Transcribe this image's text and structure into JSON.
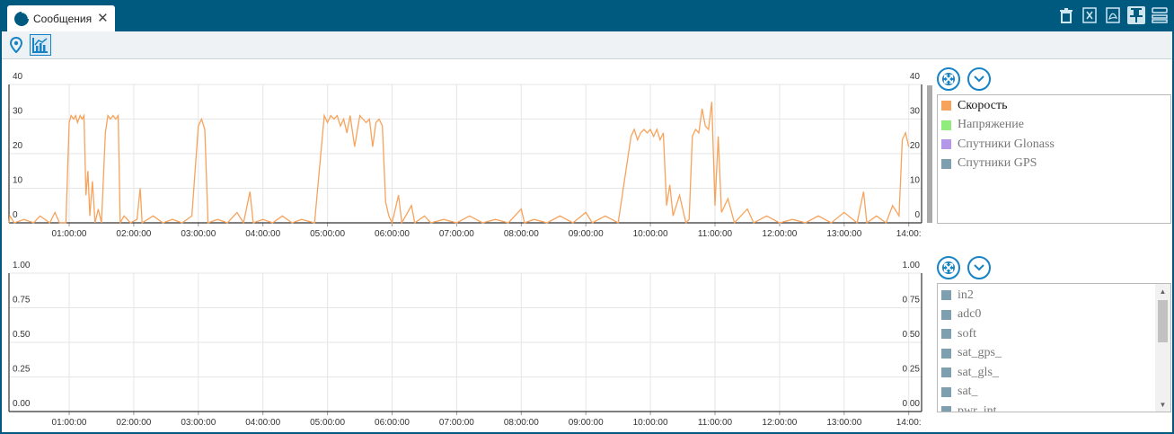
{
  "tab": {
    "label": "Сообщения",
    "close": "✕",
    "icon": "pie-chart-icon"
  },
  "titlebar_icons": [
    "trash-icon",
    "excel-icon",
    "pdf-icon",
    "pin-icon",
    "layout-icon"
  ],
  "toolbar_icons": [
    "location-pin-icon",
    "chart-icon"
  ],
  "colors": {
    "brand": "#005a7f",
    "accent": "#1783c4",
    "speed": "#f7a35c",
    "grid": "#e4e4e4"
  },
  "chart_data": [
    {
      "type": "line",
      "x_ticks": [
        "01:00:00",
        "02:00:00",
        "03:00:00",
        "04:00:00",
        "05:00:00",
        "06:00:00",
        "07:00:00",
        "08:00:00",
        "09:00:00",
        "10:00:00",
        "11:00:00",
        "12:00:00",
        "13:00:00",
        "14:00:"
      ],
      "y_ticks_left": [
        "40",
        "30",
        "20",
        "10",
        "0"
      ],
      "y_ticks_right": [
        "40",
        "30",
        "20",
        "10",
        "0"
      ],
      "ylim": [
        0,
        40
      ],
      "series": [
        {
          "name": "Скорость",
          "x_unit": "hours",
          "points": [
            [
              0.0,
              0
            ],
            [
              0.08,
              2
            ],
            [
              0.15,
              0
            ],
            [
              0.3,
              1
            ],
            [
              0.45,
              0
            ],
            [
              0.55,
              2
            ],
            [
              0.7,
              0
            ],
            [
              0.78,
              3
            ],
            [
              0.85,
              0
            ],
            [
              0.95,
              0
            ],
            [
              1.0,
              29
            ],
            [
              1.03,
              31
            ],
            [
              1.07,
              30
            ],
            [
              1.1,
              31
            ],
            [
              1.13,
              29
            ],
            [
              1.17,
              31
            ],
            [
              1.2,
              30
            ],
            [
              1.23,
              31
            ],
            [
              1.26,
              8
            ],
            [
              1.29,
              15
            ],
            [
              1.32,
              2
            ],
            [
              1.36,
              12
            ],
            [
              1.4,
              0
            ],
            [
              1.45,
              4
            ],
            [
              1.5,
              0
            ],
            [
              1.56,
              26
            ],
            [
              1.6,
              31
            ],
            [
              1.64,
              30
            ],
            [
              1.68,
              31
            ],
            [
              1.72,
              30
            ],
            [
              1.76,
              31
            ],
            [
              1.79,
              0
            ],
            [
              1.85,
              2
            ],
            [
              1.95,
              0
            ],
            [
              2.05,
              1
            ],
            [
              2.1,
              10
            ],
            [
              2.13,
              0
            ],
            [
              2.3,
              2
            ],
            [
              2.45,
              0
            ],
            [
              2.6,
              1
            ],
            [
              2.75,
              0
            ],
            [
              2.9,
              2
            ],
            [
              3.0,
              28
            ],
            [
              3.05,
              30
            ],
            [
              3.1,
              27
            ],
            [
              3.15,
              0
            ],
            [
              3.3,
              1
            ],
            [
              3.45,
              0
            ],
            [
              3.6,
              3
            ],
            [
              3.7,
              0
            ],
            [
              3.8,
              9
            ],
            [
              3.85,
              0
            ],
            [
              4.0,
              1
            ],
            [
              4.15,
              0
            ],
            [
              4.3,
              2
            ],
            [
              4.45,
              0
            ],
            [
              4.6,
              1
            ],
            [
              4.8,
              0
            ],
            [
              4.95,
              31
            ],
            [
              5.0,
              29
            ],
            [
              5.05,
              31
            ],
            [
              5.1,
              30
            ],
            [
              5.15,
              31
            ],
            [
              5.2,
              28
            ],
            [
              5.25,
              30
            ],
            [
              5.3,
              26
            ],
            [
              5.35,
              31
            ],
            [
              5.42,
              22
            ],
            [
              5.5,
              31
            ],
            [
              5.55,
              30
            ],
            [
              5.6,
              29
            ],
            [
              5.65,
              30
            ],
            [
              5.7,
              22
            ],
            [
              5.75,
              29
            ],
            [
              5.8,
              30
            ],
            [
              5.85,
              28
            ],
            [
              5.9,
              6
            ],
            [
              5.95,
              2
            ],
            [
              6.0,
              0
            ],
            [
              6.1,
              8
            ],
            [
              6.15,
              0
            ],
            [
              6.3,
              5
            ],
            [
              6.35,
              0
            ],
            [
              6.5,
              2
            ],
            [
              6.6,
              0
            ],
            [
              6.8,
              1
            ],
            [
              7.0,
              0
            ],
            [
              7.2,
              2
            ],
            [
              7.4,
              0
            ],
            [
              7.6,
              1
            ],
            [
              7.8,
              0
            ],
            [
              8.0,
              4
            ],
            [
              8.05,
              0
            ],
            [
              8.2,
              1
            ],
            [
              8.4,
              0
            ],
            [
              8.6,
              2
            ],
            [
              8.8,
              0
            ],
            [
              9.0,
              3
            ],
            [
              9.1,
              0
            ],
            [
              9.3,
              2
            ],
            [
              9.5,
              0
            ],
            [
              9.7,
              25
            ],
            [
              9.75,
              27
            ],
            [
              9.8,
              24
            ],
            [
              9.85,
              26
            ],
            [
              9.9,
              27
            ],
            [
              9.95,
              26
            ],
            [
              10.0,
              27
            ],
            [
              10.05,
              25
            ],
            [
              10.1,
              27
            ],
            [
              10.15,
              24
            ],
            [
              10.2,
              26
            ],
            [
              10.25,
              5
            ],
            [
              10.3,
              11
            ],
            [
              10.35,
              2
            ],
            [
              10.45,
              8
            ],
            [
              10.55,
              0
            ],
            [
              10.6,
              1
            ],
            [
              10.65,
              25
            ],
            [
              10.7,
              27
            ],
            [
              10.75,
              26
            ],
            [
              10.8,
              33
            ],
            [
              10.85,
              28
            ],
            [
              10.9,
              27
            ],
            [
              10.95,
              35
            ],
            [
              11.0,
              5
            ],
            [
              11.05,
              25
            ],
            [
              11.1,
              3
            ],
            [
              11.2,
              7
            ],
            [
              11.3,
              0
            ],
            [
              11.5,
              4
            ],
            [
              11.6,
              0
            ],
            [
              11.8,
              2
            ],
            [
              12.0,
              0
            ],
            [
              12.2,
              1
            ],
            [
              12.4,
              0
            ],
            [
              12.6,
              2
            ],
            [
              12.8,
              0
            ],
            [
              13.0,
              3
            ],
            [
              13.2,
              0
            ],
            [
              13.3,
              9
            ],
            [
              13.35,
              0
            ],
            [
              13.5,
              2
            ],
            [
              13.65,
              0
            ],
            [
              13.75,
              5
            ],
            [
              13.85,
              2
            ],
            [
              13.9,
              24
            ],
            [
              13.95,
              26
            ],
            [
              14.0,
              22
            ]
          ]
        }
      ]
    },
    {
      "type": "line",
      "x_ticks": [
        "01:00:00",
        "02:00:00",
        "03:00:00",
        "04:00:00",
        "05:00:00",
        "06:00:00",
        "07:00:00",
        "08:00:00",
        "09:00:00",
        "10:00:00",
        "11:00:00",
        "12:00:00",
        "13:00:00",
        "14:00:"
      ],
      "y_ticks_left": [
        "1.00",
        "0.75",
        "0.50",
        "0.25",
        "0.00"
      ],
      "y_ticks_right": [
        "1.00",
        "0.75",
        "0.50",
        "0.25",
        "0.00"
      ],
      "ylim": [
        0,
        1
      ],
      "series": []
    }
  ],
  "legend_top": [
    {
      "label": "Скорость",
      "color": "#f7a35c",
      "on": true
    },
    {
      "label": "Напряжение",
      "color": "#90ed7d",
      "on": false
    },
    {
      "label": "Спутники Glonass",
      "color": "#b497e8",
      "on": false
    },
    {
      "label": "Спутники GPS",
      "color": "#7e9faf",
      "on": false
    }
  ],
  "legend_bottom": [
    {
      "label": "in2",
      "color": "#7e9faf"
    },
    {
      "label": "adc0",
      "color": "#7e9faf"
    },
    {
      "label": "soft",
      "color": "#7e9faf"
    },
    {
      "label": "sat_gps_",
      "color": "#7e9faf"
    },
    {
      "label": "sat_gls_",
      "color": "#7e9faf"
    },
    {
      "label": "sat_",
      "color": "#7e9faf"
    },
    {
      "label": "pwr_int",
      "color": "#7e9faf"
    }
  ]
}
